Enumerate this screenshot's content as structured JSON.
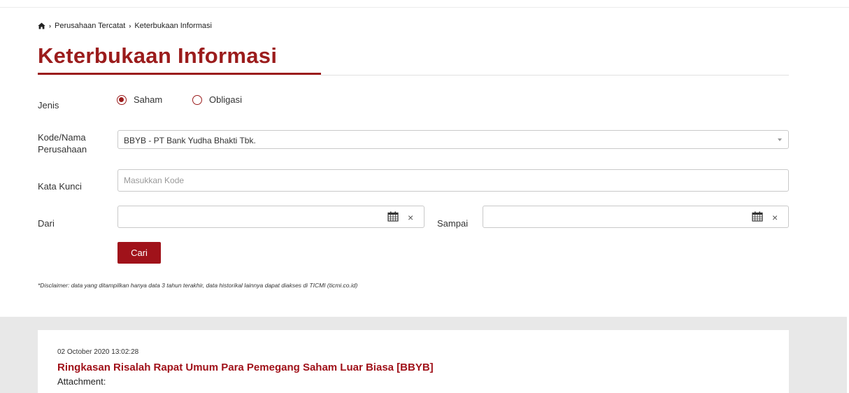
{
  "breadcrumb": {
    "items": [
      "Perusahaan Tercatat",
      "Keterbukaan Informasi"
    ]
  },
  "page_title": "Keterbukaan Informasi",
  "form": {
    "jenis_label": "Jenis",
    "jenis_options": [
      {
        "label": "Saham",
        "checked": true
      },
      {
        "label": "Obligasi",
        "checked": false
      }
    ],
    "kode_label_line1": "Kode/Nama",
    "kode_label_line2": "Perusahaan",
    "kode_value": "BBYB - PT Bank Yudha Bhakti Tbk.",
    "kata_kunci_label": "Kata Kunci",
    "kata_kunci_placeholder": "Masukkan Kode",
    "dari_label": "Dari",
    "sampai_label": "Sampai",
    "dari_value": "",
    "sampai_value": "",
    "clear_glyph": "×",
    "submit_label": "Cari"
  },
  "disclaimer": "*Disclaimer: data yang ditampilkan hanya data 3 tahun terakhir, data historikal lainnya dapat diakses di TICMI (ticmi.co.id)",
  "results": [
    {
      "date": "02 October 2020 13:02:28",
      "title": "Ringkasan Risalah Rapat Umum Para Pemegang Saham Luar Biasa [BBYB]",
      "attachment_label": "Attachment:"
    }
  ],
  "colors": {
    "accent": "#9b1c1c",
    "button": "#a0121a",
    "band": "#e8e8e8"
  },
  "icons": [
    "home-icon",
    "chevron-right-icon",
    "calendar-icon",
    "close-icon",
    "dropdown-caret-icon"
  ]
}
